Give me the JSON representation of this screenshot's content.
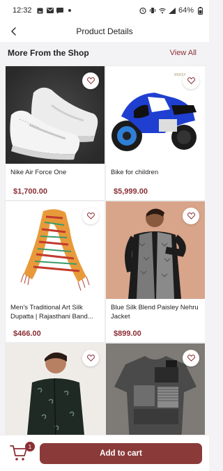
{
  "status_bar": {
    "time": "12:32",
    "battery": "64%",
    "left_icons": [
      "photo-icon",
      "mail-icon",
      "message-icon",
      "dot-icon"
    ],
    "right_icons": [
      "alarm-icon",
      "vibrate-icon",
      "wifi-icon",
      "signal-icon",
      "battery-icon"
    ]
  },
  "header": {
    "title": "Product Details",
    "back_icon": "back-arrow-icon"
  },
  "section": {
    "title": "More From the Shop",
    "view_all": "View All"
  },
  "products": [
    {
      "name": "Nike Air Force One",
      "price": "$1,700.00"
    },
    {
      "name": "Bike for children",
      "price": "$5,999.00"
    },
    {
      "name": "Men's Traditional Art Silk Dupatta | Rajasthani Band...",
      "price": "$466.00"
    },
    {
      "name": "Blue Silk Blend Paisley Nehru Jacket",
      "price": "$899.00"
    },
    {
      "name": "",
      "price": ""
    },
    {
      "name": "",
      "price": ""
    }
  ],
  "bottom_bar": {
    "cart_count": "1",
    "add_to_cart": "Add to cart"
  },
  "colors": {
    "accent": "#8b2f34",
    "button": "#8b3a3a"
  }
}
